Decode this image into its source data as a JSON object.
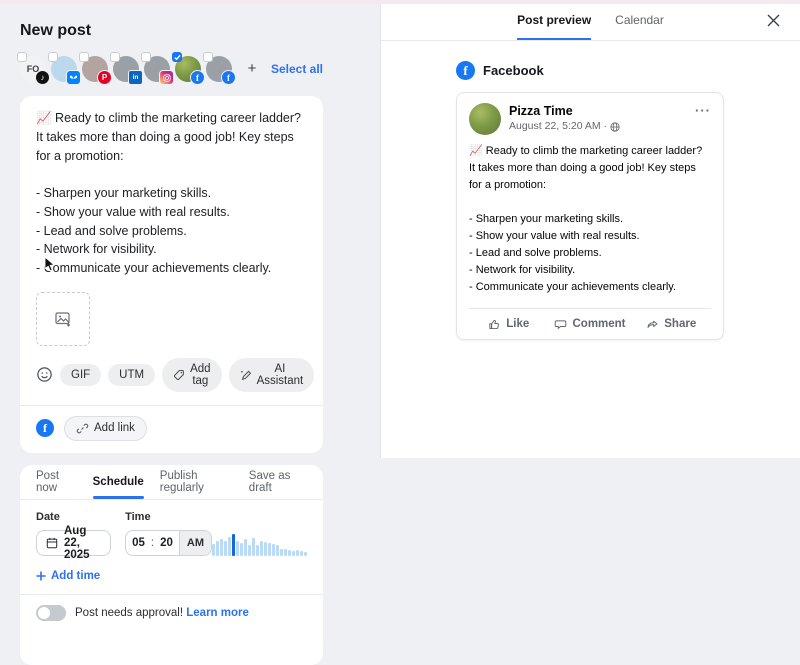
{
  "colors": {
    "accent_blue": "#2e71f0",
    "facebook_blue": "#1877f2",
    "panel_bg": "#eef0f3",
    "bar_light": "#b9dbf8",
    "bar_selected": "#1667d9"
  },
  "composer": {
    "title": "New post",
    "select_all_label": "Select all",
    "add_account_label": "+",
    "accounts": [
      {
        "name": "FO account",
        "network": "tiktok",
        "initials": "FO",
        "avatar_color": "#f1f2f4",
        "selected": false
      },
      {
        "name": "Bluesky account",
        "network": "bluesky",
        "initials": "",
        "avatar_color": "#bcd8ec",
        "selected": false
      },
      {
        "name": "Pinterest account",
        "network": "pinterest",
        "initials": "",
        "avatar_color": "#b3a4a1",
        "selected": false
      },
      {
        "name": "LinkedIn account",
        "network": "linkedin",
        "initials": "",
        "avatar_color": "#9aa0a6",
        "selected": false
      },
      {
        "name": "Instagram account",
        "network": "instagram",
        "initials": "",
        "avatar_color": "#9aa0a6",
        "selected": false
      },
      {
        "name": "Pizza Time",
        "network": "facebook",
        "initials": "",
        "avatar_color": "#7e9a47",
        "selected": true
      },
      {
        "name": "Facebook account",
        "network": "facebook",
        "initials": "",
        "avatar_color": "#9aa0a6",
        "selected": false
      }
    ],
    "post_text": "📈 Ready to climb the marketing career ladder? It takes more than doing a good job! Key steps for a promotion:\n\n- Sharpen your marketing skills.\n- Show your value with real results.\n- Lead and solve problems.\n- Network for visibility.\n- Communicate your achievements clearly.",
    "toolbar": {
      "gif_label": "GIF",
      "utm_label": "UTM",
      "add_tag_label": "Add tag",
      "ai_assistant_label": "AI Assistant"
    },
    "add_link_label": "Add link"
  },
  "schedule": {
    "tabs": [
      "Post now",
      "Schedule",
      "Publish regularly",
      "Save as draft"
    ],
    "active_tab": "Schedule",
    "date_label": "Date",
    "time_label": "Time",
    "date_value": "Aug 22, 2025",
    "time_hour": "05",
    "time_colon": ":",
    "time_minute": "20",
    "time_meridiem": "AM",
    "add_time_label": "Add time",
    "approval_label": "Post needs approval!",
    "approval_link": "Learn more",
    "chart_data": {
      "type": "bar",
      "title": "Best time to post histogram",
      "x": [
        0,
        1,
        2,
        3,
        4,
        5,
        6,
        7,
        8,
        9,
        10,
        11,
        12,
        13,
        14,
        15,
        16,
        17,
        18,
        19,
        20,
        21,
        22,
        23
      ],
      "values": [
        55,
        66,
        75,
        66,
        85,
        100,
        70,
        60,
        78,
        52,
        82,
        48,
        70,
        62,
        58,
        54,
        48,
        34,
        30,
        26,
        22,
        26,
        22,
        18
      ],
      "highlight_index": 5,
      "bar_color": "#b9dbf8",
      "highlight_color": "#1667d9"
    }
  },
  "preview": {
    "tabs": [
      "Post preview",
      "Calendar"
    ],
    "active_tab": "Post preview",
    "network_label": "Facebook",
    "page_name": "Pizza Time",
    "post_meta": "August 22, 5:20 AM ·",
    "more_label": "···",
    "actions": [
      "Like",
      "Comment",
      "Share"
    ]
  }
}
